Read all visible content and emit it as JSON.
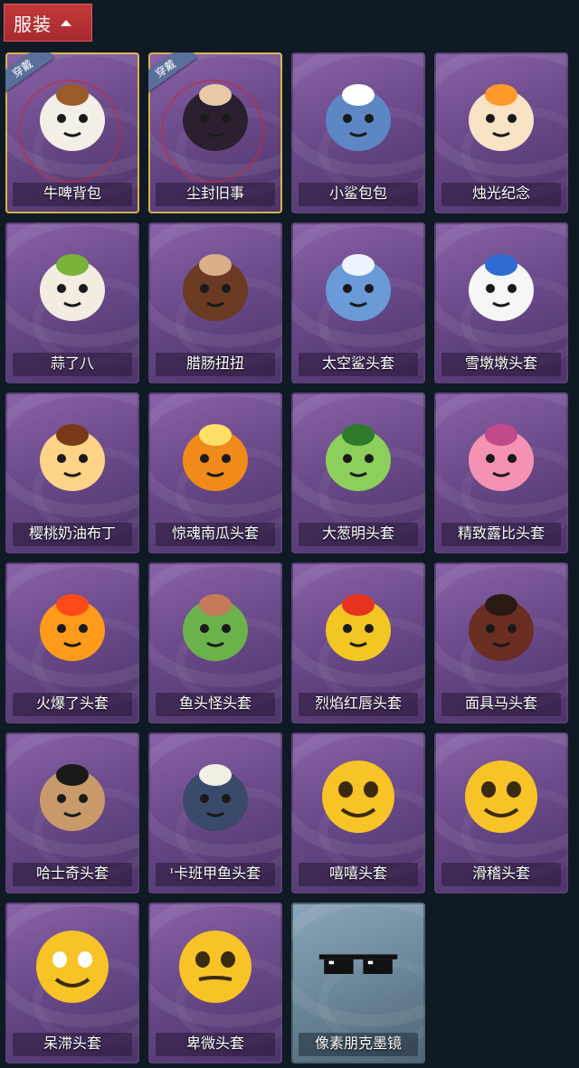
{
  "header": {
    "title": "服装"
  },
  "items": [
    {
      "label": "牛啤背包",
      "badge": "穿戴",
      "equipped": true,
      "icon": "cow-beer-backpack-icon",
      "theme": "purple",
      "main": "#f4efe6",
      "accent": "#9a5a2a"
    },
    {
      "label": "尘封旧事",
      "badge": "穿戴",
      "equipped": true,
      "icon": "dusty-past-doll-icon",
      "theme": "purple",
      "main": "#2a2030",
      "accent": "#e8c9a8"
    },
    {
      "label": "小鲨包包",
      "equipped": false,
      "icon": "shark-bag-icon",
      "theme": "purple",
      "main": "#5d86c4",
      "accent": "#ffffff"
    },
    {
      "label": "烛光纪念",
      "equipped": false,
      "icon": "candle-icon",
      "theme": "purple",
      "main": "#f8e4c4",
      "accent": "#ff9a2a"
    },
    {
      "label": "蒜了八",
      "equipped": false,
      "icon": "garlic-icon",
      "theme": "purple",
      "main": "#f3ece0",
      "accent": "#7bb33a"
    },
    {
      "label": "腊肠扭扭",
      "equipped": false,
      "icon": "dachshund-head-icon",
      "theme": "purple",
      "main": "#6a3a22",
      "accent": "#d9b089"
    },
    {
      "label": "太空鲨头套",
      "equipped": false,
      "icon": "space-shark-head-icon",
      "theme": "purple",
      "main": "#6a9ad8",
      "accent": "#eef4ff"
    },
    {
      "label": "雪墩墩头套",
      "equipped": false,
      "icon": "snowman-head-icon",
      "theme": "purple",
      "main": "#f6f6f6",
      "accent": "#2f6bd1"
    },
    {
      "label": "樱桃奶油布丁",
      "equipped": false,
      "icon": "pudding-icon",
      "theme": "purple",
      "main": "#ffd489",
      "accent": "#7a3a1a"
    },
    {
      "label": "惊魂南瓜头套",
      "equipped": false,
      "icon": "pumpkin-head-icon",
      "theme": "purple",
      "main": "#f08a1a",
      "accent": "#ffe066"
    },
    {
      "label": "大葱明头套",
      "equipped": false,
      "icon": "scallion-head-icon",
      "theme": "purple",
      "main": "#8ccf5a",
      "accent": "#2e7a2a"
    },
    {
      "label": "精致露比头套",
      "equipped": false,
      "icon": "loopy-head-icon",
      "theme": "purple",
      "main": "#f592b3",
      "accent": "#c24a8a"
    },
    {
      "label": "火爆了头套",
      "equipped": false,
      "icon": "fire-head-icon",
      "theme": "purple",
      "main": "#ff9a1a",
      "accent": "#ff4a1a"
    },
    {
      "label": "鱼头怪头套",
      "equipped": false,
      "icon": "fish-monster-head-icon",
      "theme": "purple",
      "main": "#6bb24a",
      "accent": "#c77a5a"
    },
    {
      "label": "烈焰红唇头套",
      "equipped": false,
      "icon": "pikachu-lips-head-icon",
      "theme": "purple",
      "main": "#f2c623",
      "accent": "#e5331f"
    },
    {
      "label": "面具马头套",
      "equipped": false,
      "icon": "horse-mask-head-icon",
      "theme": "purple",
      "main": "#6a2f22",
      "accent": "#2a1a14"
    },
    {
      "label": "哈士奇头套",
      "equipped": false,
      "icon": "husky-head-icon",
      "theme": "purple",
      "main": "#c89a6a",
      "accent": "#1a1a1a"
    },
    {
      "label": "卡班甲鱼头套",
      "prefix": "ᶦ",
      "equipped": false,
      "icon": "turtle-head-icon",
      "theme": "purple",
      "main": "#3a4a6a",
      "accent": "#f3eee4"
    },
    {
      "label": "嘻嘻头套",
      "equipped": false,
      "icon": "grin-face-head-icon",
      "theme": "purple",
      "main": "#f7c326",
      "accent": "#3a2a10"
    },
    {
      "label": "滑稽头套",
      "equipped": false,
      "icon": "funny-face-head-icon",
      "theme": "purple",
      "main": "#f7c326",
      "accent": "#e86a5a"
    },
    {
      "label": "呆滞头套",
      "equipped": false,
      "icon": "dazed-face-head-icon",
      "theme": "purple",
      "main": "#f7c326",
      "accent": "#ffffff"
    },
    {
      "label": "卑微头套",
      "equipped": false,
      "icon": "humble-face-head-icon",
      "theme": "purple",
      "main": "#f7c326",
      "accent": "#3a2a10"
    },
    {
      "label": "像素朋克墨镜",
      "equipped": false,
      "icon": "pixel-sunglasses-icon",
      "theme": "blue",
      "main": "#111111",
      "accent": "#ffffff"
    }
  ]
}
